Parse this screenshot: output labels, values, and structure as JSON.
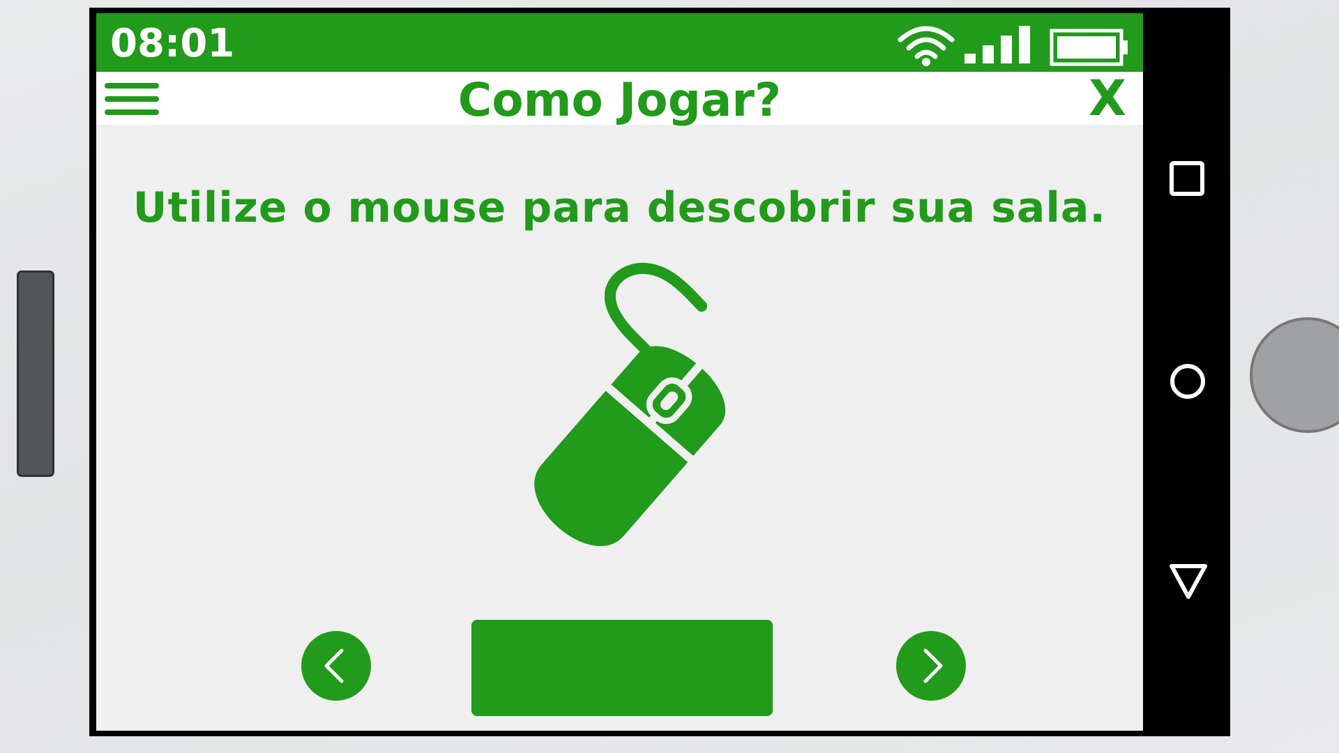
{
  "status_bar": {
    "time": "08:01",
    "icons": [
      "wifi-icon",
      "signal-icon",
      "battery-icon"
    ]
  },
  "app_bar": {
    "title": "Como Jogar?",
    "close_label": "X",
    "menu_icon": "hamburger-menu-icon"
  },
  "content": {
    "instruction": "Utilize o mouse para descobrir sua sala.",
    "illustration_icon": "computer-mouse-icon"
  },
  "navigation": {
    "prev_icon": "chevron-left-icon",
    "next_icon": "chevron-right-icon",
    "center_button_label": ""
  },
  "system_nav": [
    "recent-apps-icon",
    "home-icon",
    "back-icon"
  ],
  "colors": {
    "primary_green": "#229a1b",
    "screen_bg": "#efefef",
    "frame": "#000000"
  }
}
